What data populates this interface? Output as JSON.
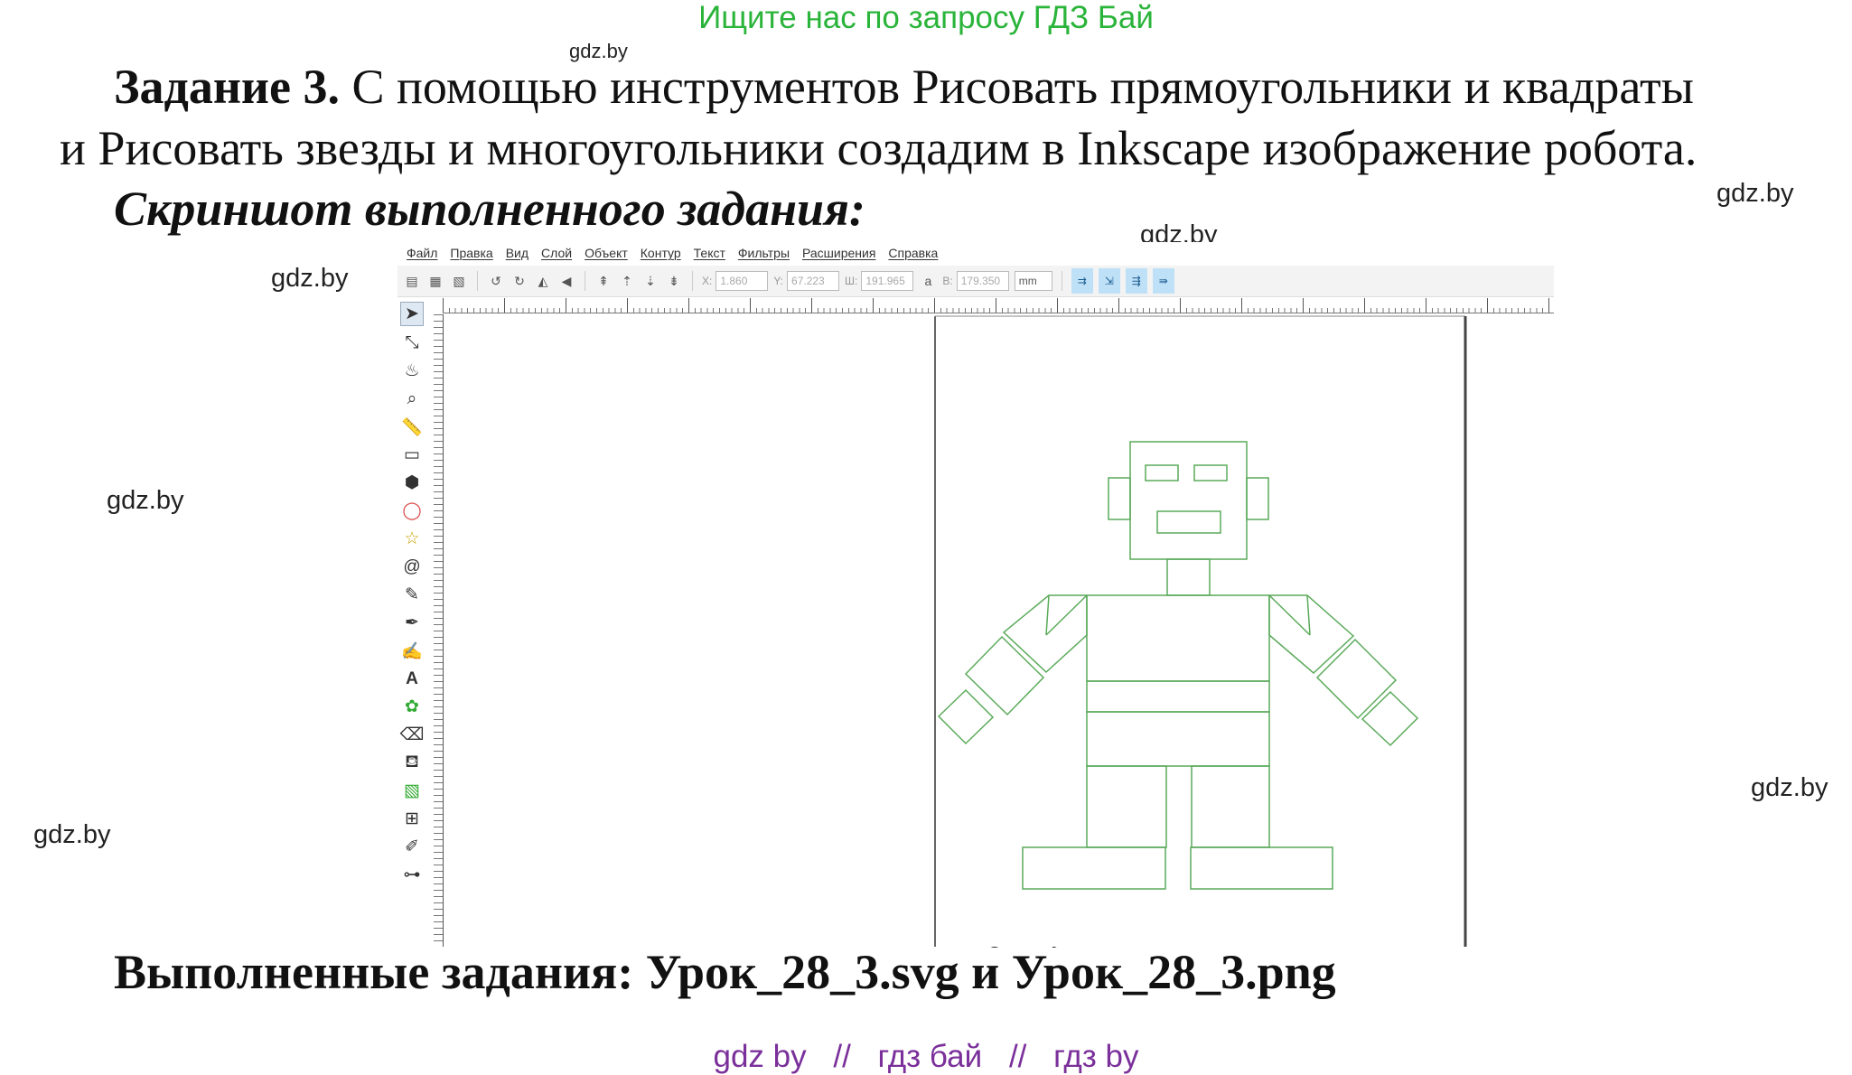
{
  "banner": "Ищите нас по запросу ГДЗ Бай",
  "watermark": "gdz.by",
  "task": {
    "number": "Задание 3.",
    "line1": " С помощью инструментов Рисовать прямоугольники и квадраты",
    "line2": "и Рисовать звезды и многоугольники создадим в Inkscape изображение робота."
  },
  "subheading": "Скриншот выполненного задания:",
  "completed": "Выполненные задания: Урок_28_3.svg и Урок_28_3.png",
  "footer": {
    "a": "gdz by",
    "sep": "//",
    "b": "гдз бай",
    "c": "гдз by"
  },
  "inkscape": {
    "menu": [
      "Файл",
      "Правка",
      "Вид",
      "Слой",
      "Объект",
      "Контур",
      "Текст",
      "Фильтры",
      "Расширения",
      "Справка"
    ],
    "coords": {
      "x_label": "X:",
      "x": "1.860",
      "y_label": "Y:",
      "y": "67.223",
      "w_label": "Ш:",
      "w": "191.965",
      "h_label": "В:",
      "h": "179.350",
      "unit": "mm"
    },
    "tools": [
      "select-arrow-icon",
      "node-icon",
      "tweak-icon",
      "zoom-icon",
      "measure-icon",
      "rectangle-icon",
      "3d-box-icon",
      "ellipse-icon",
      "star-icon",
      "spiral-icon",
      "pencil-icon",
      "pen-icon",
      "calligraphy-icon",
      "text-icon",
      "spray-icon",
      "eraser-icon",
      "bucket-icon",
      "gradient-icon",
      "mesh-icon",
      "dropper-icon",
      "connector-icon"
    ],
    "shape_color": "#5aaa5a"
  }
}
